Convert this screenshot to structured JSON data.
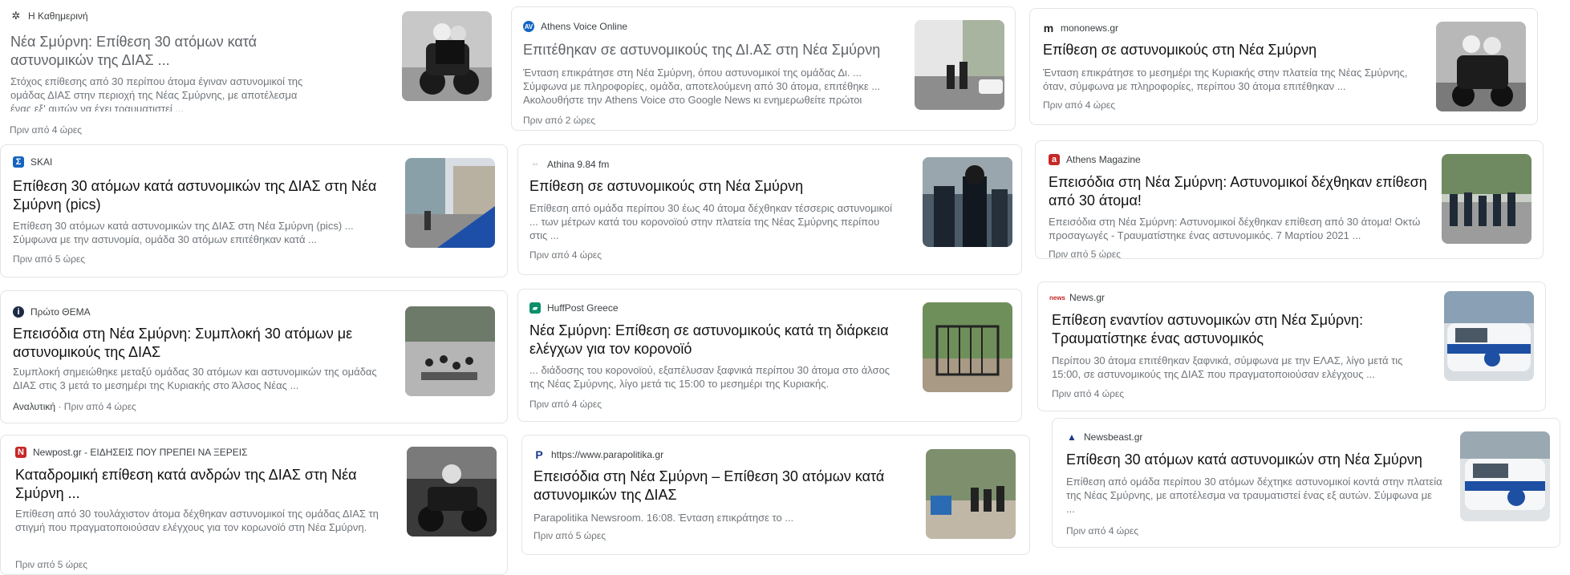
{
  "cards": [
    {
      "source": "Η Καθημερινή",
      "title": "Νέα Σμύρνη: Επίθεση 30 ατόμων κατά αστυνομικών της ΔΙΑΣ ...",
      "snippet": "Στόχος επίθεσης από 30 περίπου άτομα έγιναν αστυνομικοί της ομάδας ΔΙΑΣ στην περιοχή της Νέας Σμύρνης, με αποτέλεσμα ένας εξ' αυτών να έχει τραυματιστεί ...",
      "time": "Πριν από 4 ώρες"
    },
    {
      "source": "SKAI",
      "title": "Επίθεση 30 ατόμων κατά αστυνομικών της ΔΙΑΣ στη Νέα Σμύρνη (pics)",
      "snippet": "Επίθεση 30 ατόμων κατά αστυνομικών της ΔΙΑΣ στη Νέα Σμύρνη (pics) ... Σύμφωνα με την αστυνομία, ομάδα 30 ατόμων επιτέθηκαν κατά ...",
      "time": "Πριν από 5 ώρες"
    },
    {
      "source": "Πρώτο ΘΕΜΑ",
      "title": "Επεισόδια στη Νέα Σμύρνη: Συμπλοκή 30 ατόμων με αστυνομικούς της ΔΙΑΣ",
      "snippet": "Συμπλοκή σημειώθηκε μεταξύ ομάδας 30 ατόμων και αστυνομικών της ομάδας ΔΙΑΣ στις 3 μετά το μεσημέρι της Κυριακής στο Άλσος Νέας ...",
      "label": "Αναλυτική",
      "time": "Πριν από 4 ώρες"
    },
    {
      "source": "Newpost.gr - ΕΙΔΗΣΕΙΣ ΠΟΥ ΠΡΕΠΕΙ ΝΑ ΞΕΡΕΙΣ",
      "title": "Καταδρομική επίθεση κατά ανδρών της ΔΙΑΣ στη Νέα Σμύρνη ...",
      "snippet": "Επίθεση από 30 τουλάχιστον άτομα δέχθηκαν αστυνομικοί της ομάδας ΔΙΑΣ τη στιγμή που πραγματοποιούσαν ελέγχους για τον κορωνοϊό στη Νέα Σμύρνη.",
      "time": "Πριν από 5 ώρες"
    },
    {
      "source": "Athens Voice Online",
      "title": "Επιτέθηκαν σε αστυνομικούς της ΔΙ.ΑΣ στη Νέα Σμύρνη",
      "snippet": "Ένταση επικράτησε στη Νέα Σμύρνη, όπου αστυνομικοί της ομάδας Δι. ... Σύμφωνα με πληροφορίες, ομάδα, αποτελούμενη από 30 άτομα, επιτέθηκε ... Ακολουθήστε την Athens Voice στο Google News κι ενημερωθείτε πρώτοι",
      "time": "Πριν από 2 ώρες"
    },
    {
      "source": "Athina 9.84 fm",
      "title": "Επίθεση σε αστυνομικούς στη Νέα Σμύρνη",
      "snippet": "Επίθεση από ομάδα περίπου 30 έως 40 άτομα δέχθηκαν τέσσερις αστυνομικοί ... των μέτρων κατά του κορονοϊού στην πλατεία της Νέας Σμύρνης περίπου στις ...",
      "time": "Πριν από 4 ώρες"
    },
    {
      "source": "HuffPost Greece",
      "title": "Νέα Σμύρνη: Επίθεση σε αστυνομικούς κατά τη διάρκεια ελέγχων για τον κορονοϊό",
      "snippet": "... διάδοσης του κορονοϊού, εξαπέλυσαν ξαφνικά περίπου 30 άτομα στο άλσος της Νέας Σμύρνης, λίγο μετά τις 15:00 το μεσημέρι της Κυριακής.",
      "time": "Πριν από 4 ώρες"
    },
    {
      "source": "https://www.parapolitika.gr",
      "title": "Επεισόδια στη Νέα Σμύρνη – Επίθεση 30 ατόμων κατά αστυνομικών της ΔΙΑΣ",
      "snippet": "Parapolitika Newsroom. 16:08. Ένταση επικράτησε το ...",
      "time": "Πριν από 5 ώρες"
    },
    {
      "source": "mononews.gr",
      "title": "Επίθεση σε αστυνομικούς στη Νέα Σμύρνη",
      "snippet": "Ένταση επικράτησε το μεσημέρι της Κυριακής στην πλατεία της Νέας Σμύρνης, όταν, σύμφωνα με πληροφορίες, περίπου 30 άτομα επιτέθηκαν ...",
      "time": "Πριν από 4 ώρες"
    },
    {
      "source": "Athens Magazine",
      "title": "Επεισόδια στη Νέα Σμύρνη: Αστυνομικοί δέχθηκαν επίθεση από 30 άτομα!",
      "snippet": "Επεισόδια στη Νέα Σμύρνη: Αστυνομικοί δέχθηκαν επίθεση από 30 άτομα! Οκτώ προσαγωγές - Τραυματίστηκε ένας αστυνομικός. 7 Μαρτίου 2021 ...",
      "time": "Πριν από 5 ώρες"
    },
    {
      "source": "News.gr",
      "title": "Επίθεση εναντίον αστυνομικών στη Νέα Σμύρνη: Τραυματίστηκε ένας αστυνομικός",
      "snippet": "Περίπου 30 άτομα επιτέθηκαν ξαφνικά, σύμφωνα με την ΕΛΑΣ, λίγο μετά τις 15:00, σε αστυνομικούς της ΔΙΑΣ που πραγματοποιούσαν ελέγχους ...",
      "time": "Πριν από 4 ώρες"
    },
    {
      "source": "Newsbeast.gr",
      "title": "Επίθεση 30 ατόμων κατά αστυνομικών στη Νέα Σμύρνη",
      "snippet": "Επίθεση από ομάδα περίπου 30 ατόμων δέχτηκε αστυνομικοί κοντά στην πλατεία της Νέας Σμύρνης, με αποτέλεσμα να τραυματιστεί ένας εξ αυτών. Σύμφωνα με ...",
      "time": "Πριν από 4 ώρες"
    }
  ],
  "icons": [
    "kathimerini-logo-icon",
    "skai-logo-icon",
    "protothema-logo-icon",
    "newpost-logo-icon",
    "athensvoice-logo-icon",
    "athina984-logo-icon",
    "huffpost-logo-icon",
    "parapolitika-logo-icon",
    "mononews-logo-icon",
    "athensmagazine-logo-icon",
    "newsgr-logo-icon",
    "newsbeast-logo-icon"
  ]
}
